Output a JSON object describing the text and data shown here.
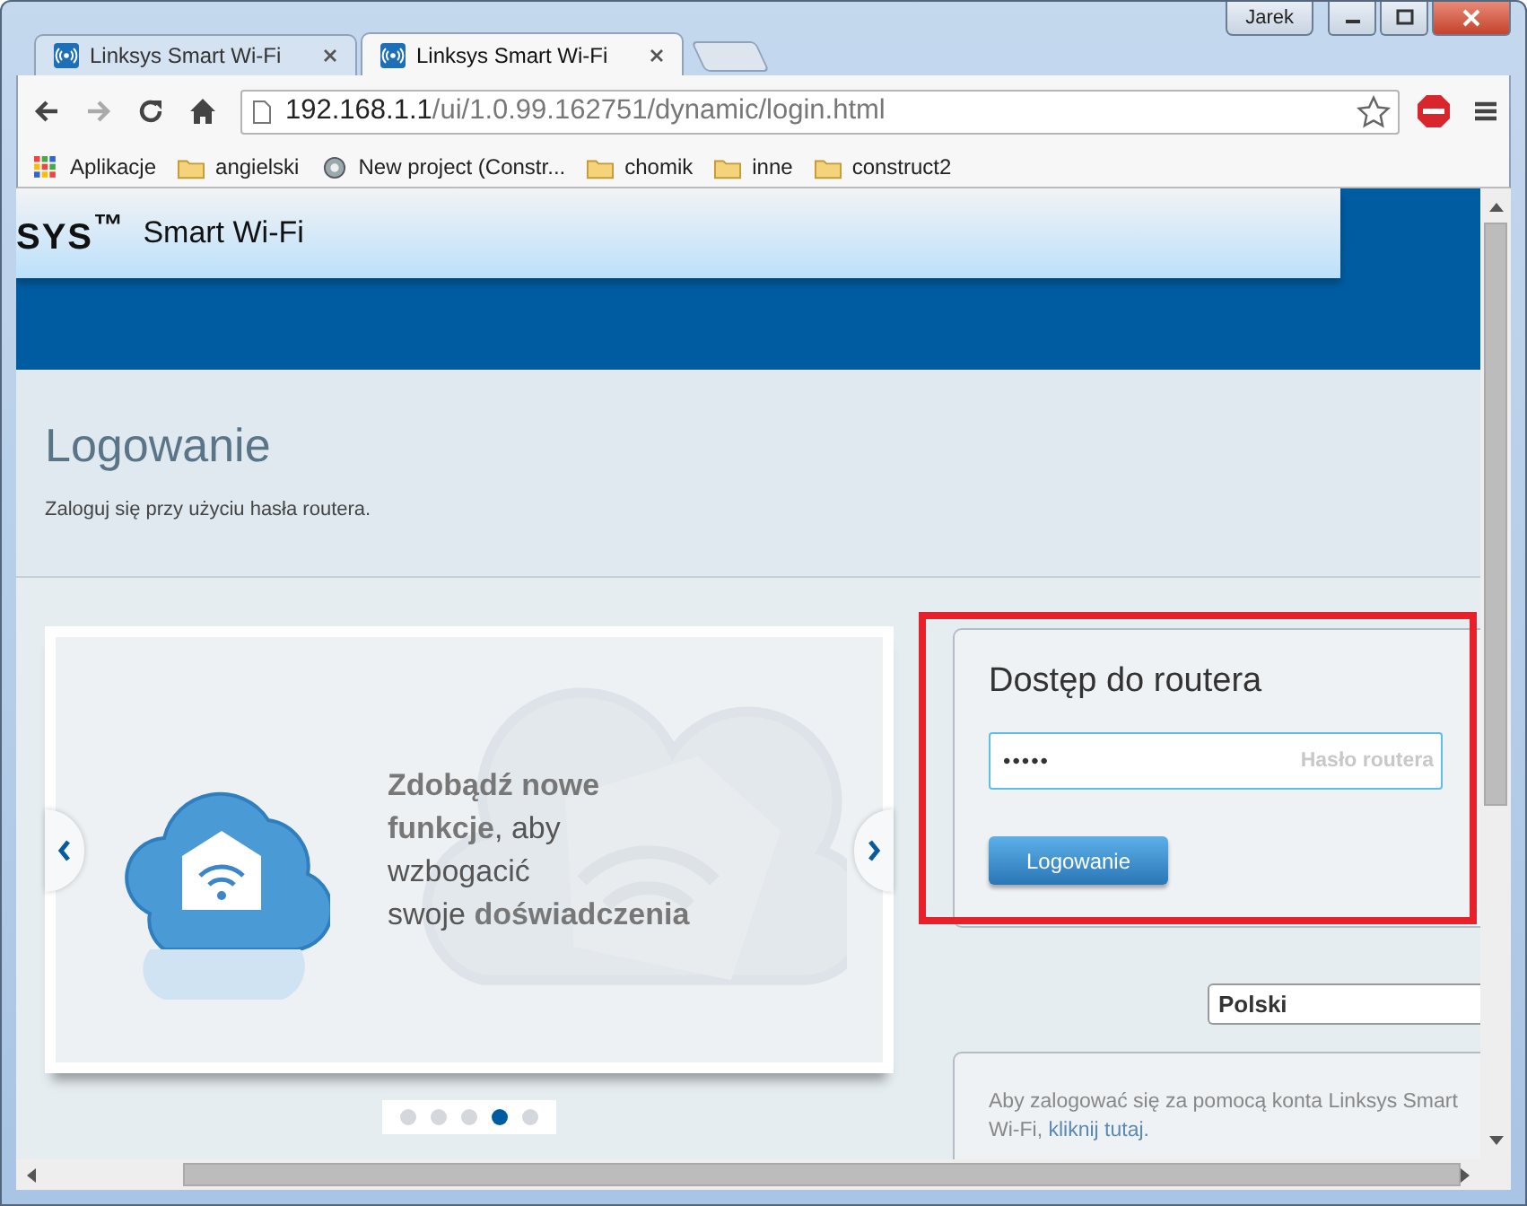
{
  "window": {
    "user": "Jarek"
  },
  "tabs": [
    {
      "title": "Linksys Smart Wi-Fi",
      "selected": false
    },
    {
      "title": "Linksys Smart Wi-Fi",
      "selected": true
    }
  ],
  "address_bar": {
    "host": "192.168.1.1",
    "path": "/ui/1.0.99.162751/dynamic/login.html"
  },
  "bookmarks": [
    {
      "kind": "apps",
      "label": "Aplikacje"
    },
    {
      "kind": "folder",
      "label": "angielski"
    },
    {
      "kind": "page",
      "label": "New project (Constr..."
    },
    {
      "kind": "folder",
      "label": "chomik"
    },
    {
      "kind": "folder",
      "label": "inne"
    },
    {
      "kind": "folder",
      "label": "construct2"
    }
  ],
  "header": {
    "logo": "SYS$^{™}$",
    "product": "Smart Wi-Fi"
  },
  "page": {
    "title": "Logowanie",
    "subtitle": "Zaloguj się przy użyciu hasła routera."
  },
  "carousel": {
    "lines": [
      "**Zdobądź nowe**",
      "**funkcje**, aby",
      "wzbogacić",
      "swoje **doświadczenia**"
    ],
    "dots": [
      {
        "selected": false
      },
      {
        "selected": false
      },
      {
        "selected": false
      },
      {
        "selected": true
      },
      {
        "selected": false
      }
    ]
  },
  "login": {
    "title": "Dostęp do routera",
    "password": {
      "value": "•••••",
      "label": "Hasło routera"
    },
    "button": "Logowanie"
  },
  "language": {
    "value": "Polski"
  },
  "info": {
    "line1": "Aby zalogować się za pomocą konta Linksys Smart",
    "line2": "Wi-Fi,",
    "link": "kliknij tutaj."
  }
}
